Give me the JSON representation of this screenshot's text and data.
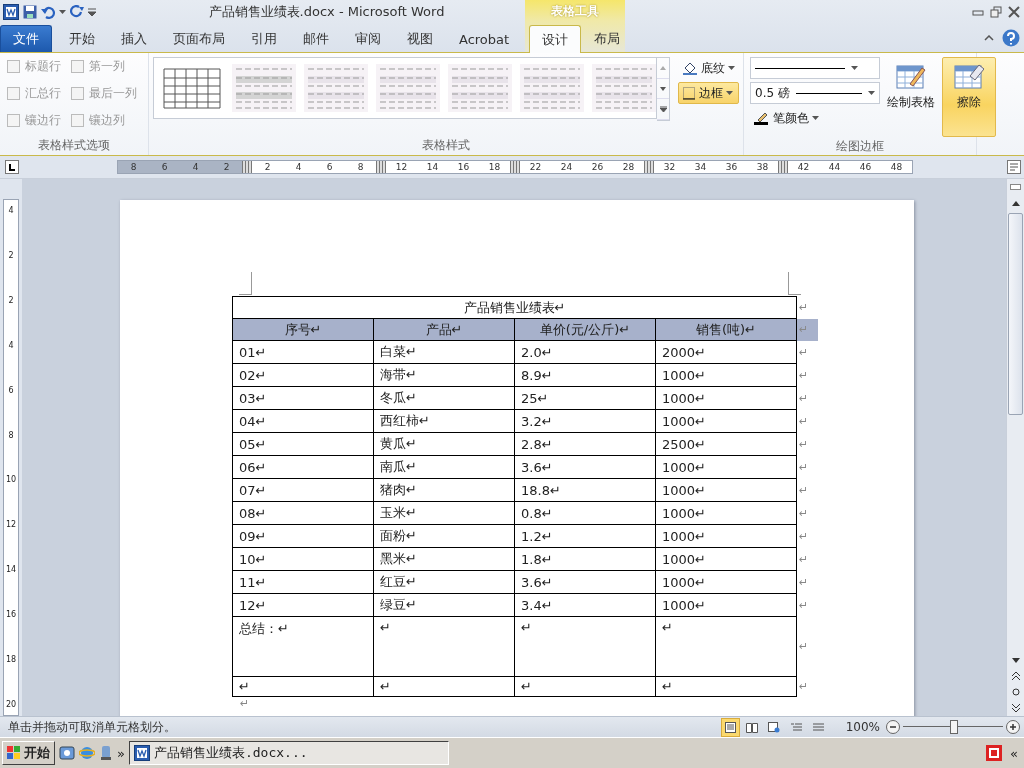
{
  "title_bar": {
    "title": "产品销售业绩表.docx - Microsoft Word",
    "contextual_label": "表格工具"
  },
  "ribbon_tabs": [
    {
      "label": "文件",
      "kind": "file",
      "selected": false
    },
    {
      "label": "开始",
      "kind": "normal",
      "selected": false
    },
    {
      "label": "插入",
      "kind": "normal",
      "selected": false
    },
    {
      "label": "页面布局",
      "kind": "normal",
      "selected": false
    },
    {
      "label": "引用",
      "kind": "normal",
      "selected": false
    },
    {
      "label": "邮件",
      "kind": "normal",
      "selected": false
    },
    {
      "label": "审阅",
      "kind": "normal",
      "selected": false
    },
    {
      "label": "视图",
      "kind": "normal",
      "selected": false
    },
    {
      "label": "Acrobat",
      "kind": "normal",
      "selected": false
    },
    {
      "label": "设计",
      "kind": "contextual",
      "selected": true
    },
    {
      "label": "布局",
      "kind": "contextual",
      "selected": false
    }
  ],
  "style_options": {
    "group_label": "表格样式选项",
    "items": [
      {
        "label": "标题行",
        "checked": false
      },
      {
        "label": "第一列",
        "checked": false
      },
      {
        "label": "汇总行",
        "checked": false
      },
      {
        "label": "最后一列",
        "checked": false
      },
      {
        "label": "镶边行",
        "checked": false
      },
      {
        "label": "镶边列",
        "checked": false
      }
    ]
  },
  "table_styles": {
    "group_label": "表格样式",
    "shading": "底纹",
    "borders": {
      "label": "边框",
      "active": true
    }
  },
  "draw_borders": {
    "group_label": "绘图边框",
    "pen_weight": "0.5 磅",
    "pen_color": "笔颜色",
    "draw_table": {
      "label": "绘制表格",
      "active": false
    },
    "eraser": {
      "label": "擦除",
      "active": true
    }
  },
  "ruler": {
    "segments": [
      {
        "labels": [
          "8",
          "6",
          "4",
          "2"
        ],
        "shaded": true
      },
      {
        "labels": [
          "2",
          "4",
          "6",
          "8"
        ],
        "shaded": false
      },
      {
        "labels": [
          "12",
          "14",
          "16",
          "18"
        ],
        "shaded": false
      },
      {
        "labels": [
          "22",
          "24",
          "26",
          "28"
        ],
        "shaded": false
      },
      {
        "labels": [
          "32",
          "34",
          "36",
          "38"
        ],
        "shaded": false
      },
      {
        "labels": [
          "42",
          "44",
          "46",
          "48"
        ],
        "shaded": false
      }
    ]
  },
  "vertical_ruler": [
    "4",
    "2",
    "2",
    "4",
    "6",
    "8",
    "10",
    "12",
    "14",
    "16",
    "18",
    "20"
  ],
  "table": {
    "title": "产品销售业绩表↵",
    "title_end": "↵",
    "columns": [
      "序号↵",
      "产品↵",
      "单价(元/公斤)↵",
      "销售(吨)↵"
    ],
    "header_end": "↵",
    "rows": [
      {
        "cells": [
          "01↵",
          "白菜↵",
          "2.0↵",
          "2000↵"
        ],
        "end": "↵"
      },
      {
        "cells": [
          "02↵",
          "海带↵",
          "8.9↵",
          "1000↵"
        ],
        "end": "↵"
      },
      {
        "cells": [
          "03↵",
          "冬瓜↵",
          "25↵",
          "1000↵"
        ],
        "end": "↵"
      },
      {
        "cells": [
          "04↵",
          "西红柿↵",
          "3.2↵",
          "1000↵"
        ],
        "end": "↵"
      },
      {
        "cells": [
          "05↵",
          "黄瓜↵",
          "2.8↵",
          "2500↵"
        ],
        "end": "↵"
      },
      {
        "cells": [
          "06↵",
          "南瓜↵",
          "3.6↵",
          "1000↵"
        ],
        "end": "↵"
      },
      {
        "cells": [
          "07↵",
          "猪肉↵",
          "18.8↵",
          "1000↵"
        ],
        "end": "↵"
      },
      {
        "cells": [
          "08↵",
          "玉米↵",
          "0.8↵",
          "1000↵"
        ],
        "end": "↵"
      },
      {
        "cells": [
          "09↵",
          "面粉↵",
          "1.2↵",
          "1000↵"
        ],
        "end": "↵"
      },
      {
        "cells": [
          "10↵",
          "黑米↵",
          "1.8↵",
          "1000↵"
        ],
        "end": "↵"
      },
      {
        "cells": [
          "11↵",
          "红豆↵",
          "3.6↵",
          "1000↵"
        ],
        "end": "↵"
      },
      {
        "cells": [
          "12↵",
          "绿豆↵",
          "3.4↵",
          "1000↵"
        ],
        "end": "↵"
      }
    ],
    "summary": {
      "cells": [
        "总结：↵",
        "↵",
        "↵",
        "↵"
      ],
      "end": "↵"
    },
    "empty_row": {
      "cells": [
        "↵",
        "↵",
        "↵",
        "↵"
      ],
      "end": "↵"
    },
    "after": "↵"
  },
  "status_bar": {
    "message": "单击并拖动可取消单元格划分。",
    "views": [
      {
        "selected": true
      },
      {
        "selected": false
      },
      {
        "selected": false
      },
      {
        "selected": false
      },
      {
        "selected": false
      }
    ],
    "zoom": "100%",
    "zoom_slider": {
      "level": 0.5
    }
  },
  "taskbar": {
    "start": "开始",
    "more": "»",
    "task": "产品销售业绩表.docx...",
    "tray_toggle": "«"
  }
}
